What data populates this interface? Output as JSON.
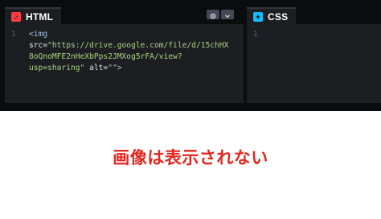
{
  "html_panel": {
    "tab_label": "HTML",
    "icon": "html-pen-icon",
    "controls": [
      "gear-icon",
      "chevron-down-icon"
    ],
    "line_numbers": [
      "1"
    ],
    "code": {
      "tag_open": "<img",
      "attr_src": "src",
      "eq": "=",
      "src_value_1": "\"https://drive.google.com/file/d/15chHX",
      "src_value_2": "8oQnoMFE2nHeXbPps2JMXog5rFA/view?",
      "src_value_3": "usp=sharing\"",
      "attr_alt": "alt",
      "alt_value": "\"\"",
      "tag_close": ">"
    }
  },
  "css_panel": {
    "tab_label": "CSS",
    "icon": "css-star-icon",
    "line_numbers": [
      "1"
    ]
  },
  "notice": {
    "text": "画像は表示されない"
  },
  "colors": {
    "editor_bg": "#1d1e22",
    "background": "#0b0c0e",
    "html_accent": "#ff3c41",
    "css_accent": "#0ebeff",
    "notice_red": "#e3261f"
  }
}
